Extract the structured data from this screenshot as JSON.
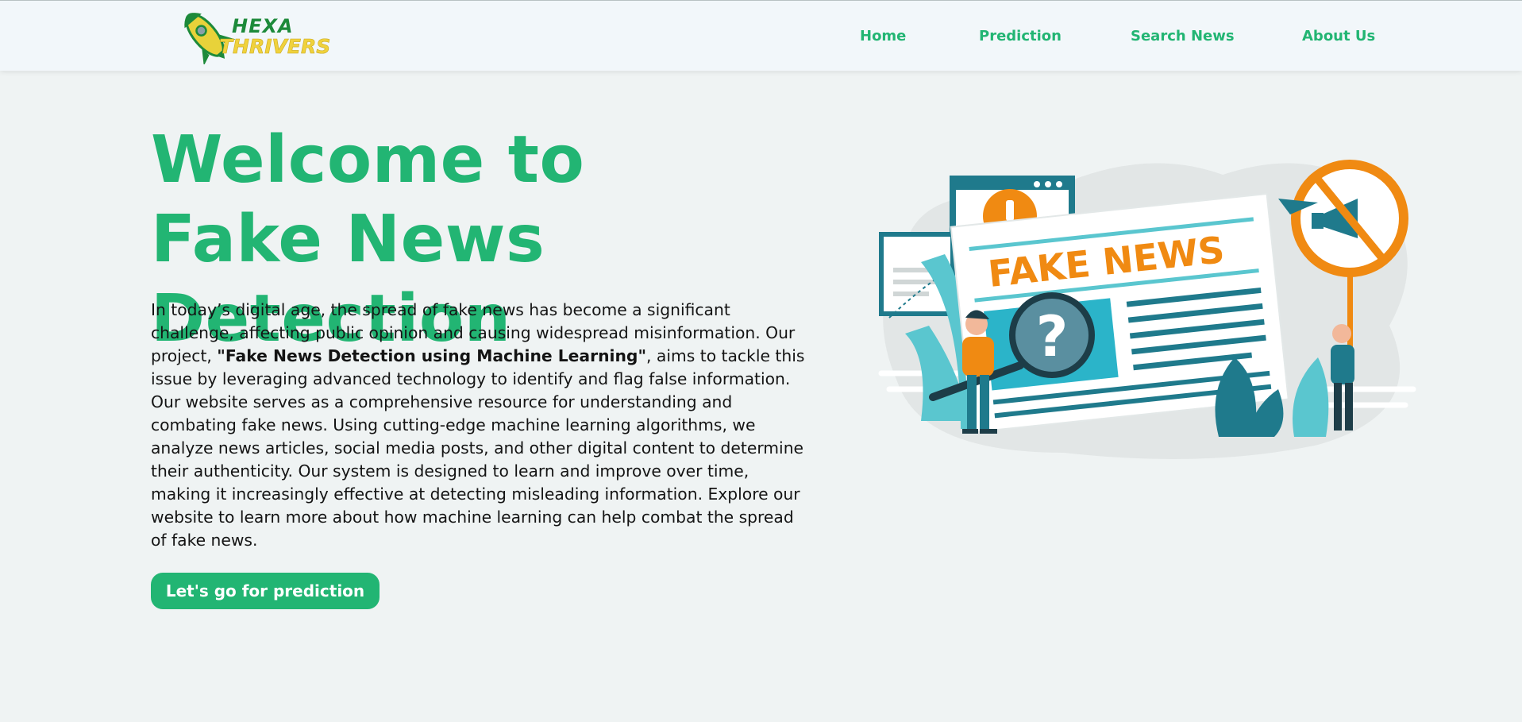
{
  "brand": {
    "line1": "HEXA",
    "line2": "THRIVERS",
    "colors": {
      "green": "#1d8a3a",
      "yellow": "#f0d23c"
    },
    "icon": "rocket-icon"
  },
  "nav": {
    "items": [
      {
        "label": "Home"
      },
      {
        "label": "Prediction"
      },
      {
        "label": "Search News"
      },
      {
        "label": "About Us"
      }
    ]
  },
  "hero": {
    "title": "Welcome to Fake News Detection",
    "paragraph_part1": "In today’s digital age, the spread of fake news has become a significant challenge, affecting public opinion and causing widespread misinformation. Our project, ",
    "paragraph_bold": "\"Fake News Detection using Machine Learning\"",
    "paragraph_part2": ", aims to tackle this issue by leveraging advanced technology to identify and flag false information. Our website serves as a comprehensive resource for understanding and combating fake news. Using cutting-edge machine learning algorithms, we analyze news articles, social media posts, and other digital content to determine their authenticity. Our system is designed to learn and improve over time, making it increasingly effective at detecting misleading information. Explore our website to learn more about how machine learning can help combat the spread of fake news.",
    "cta_label": "Let's go for prediction"
  },
  "illustration": {
    "headline": "FAKE NEWS",
    "question_mark": "?",
    "alert_mark": "!"
  },
  "colors": {
    "accent": "#22b573",
    "background": "#eff3f3",
    "navbar": "#f2f7fa",
    "teal": "#1f7a8c",
    "orange": "#f08a12"
  }
}
